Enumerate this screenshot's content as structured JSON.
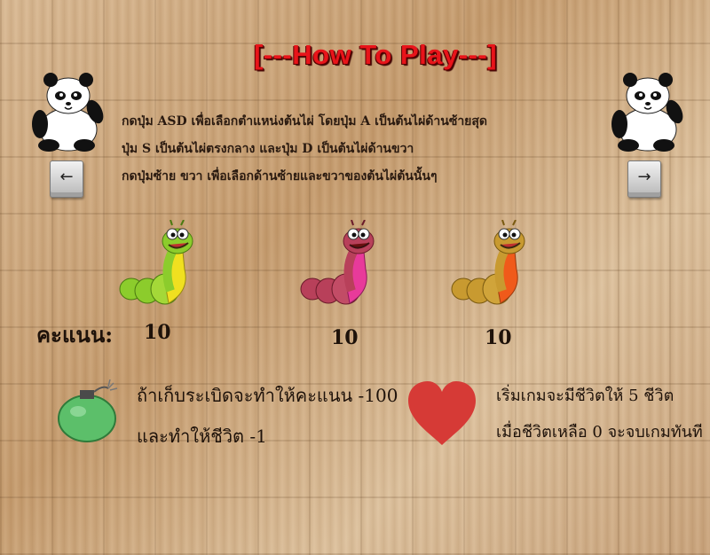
{
  "title": "[---How To Play---]",
  "instructions": [
    "กดปุ่ม ASD เพื่อเลือกตำแหน่งต้นไผ่ โดยปุ่ม A เป็นต้นไผ่ด้านซ้ายสุด",
    "ปุ่ม S เป็นต้นไผ่ตรงกลาง และปุ่ม D เป็นต้นไผ่ด้านขวา",
    "กดปุ่มซ้าย ขวา เพื่อเลือกด้านซ้ายและขวาของต้นไผ่ต้นนั้นๆ"
  ],
  "keys": {
    "left": "←",
    "right": "→"
  },
  "score_label": "คะแนน:",
  "worms": [
    {
      "icon": "green-worm-icon",
      "score": "10",
      "colors": [
        "#8ccc2c",
        "#f0e020"
      ]
    },
    {
      "icon": "pink-worm-icon",
      "score": "10",
      "colors": [
        "#b8405a",
        "#e83a9a"
      ]
    },
    {
      "icon": "orange-worm-icon",
      "score": "10",
      "colors": [
        "#c89a30",
        "#f05a1a"
      ]
    }
  ],
  "bomb": {
    "icon": "bomb-icon",
    "line1": "ถ้าเก็บระเบิดจะทำให้คะแนน -100",
    "line2": "และทำให้ชีวิต -1"
  },
  "life": {
    "icon": "heart-icon",
    "line1": "เริ่มเกมจะมีชีวิตให้ 5 ชีวิต",
    "line2": "เมื่อชีวิตเหลือ 0 จะจบเกมทันที"
  },
  "colors": {
    "title": "#e8141a",
    "heart": "#d63a36",
    "bomb": "#5cbf6a"
  }
}
